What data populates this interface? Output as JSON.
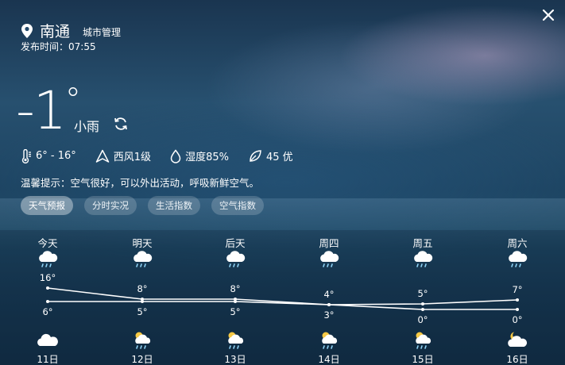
{
  "location": {
    "city": "南通",
    "manage_label": "城市管理",
    "icon": "location-pin-icon"
  },
  "publish": {
    "label": "发布时间：",
    "time": "07:55"
  },
  "current": {
    "temp": "-1",
    "unit": "°",
    "condition": "小雨",
    "range": "6° - 16°",
    "wind": "西风1级",
    "humidity": "湿度85%",
    "aqi": "45 优"
  },
  "tip": "温馨提示：空气很好，可以外出活动，呼吸新鲜空气。",
  "tabs": [
    "天气预报",
    "分时实况",
    "生活指数",
    "空气指数"
  ],
  "active_tab": "天气预报",
  "forecast": {
    "days": [
      "今天",
      "明天",
      "后天",
      "周四",
      "周五",
      "周六"
    ],
    "dates": [
      "11日",
      "12日",
      "13日",
      "14日",
      "15日",
      "16日"
    ],
    "highs": [
      16,
      8,
      8,
      4,
      5,
      7
    ],
    "lows": [
      6,
      5,
      5,
      3,
      0,
      0
    ],
    "high_labels": [
      "16°",
      "8°",
      "8°",
      "4°",
      "5°",
      "7°"
    ],
    "low_labels": [
      "6°",
      "5°",
      "5°",
      "3°",
      "0°",
      "0°"
    ],
    "day_icons": [
      "light-rain-icon",
      "light-rain-icon",
      "light-rain-icon",
      "light-rain-icon",
      "light-rain-icon",
      "light-rain-icon"
    ],
    "night_icons": [
      "cloudy-icon",
      "partly-cloudy-rain-icon",
      "partly-cloudy-rain-icon",
      "partly-cloudy-rain-icon",
      "partly-cloudy-rain-icon",
      "partly-cloudy-moon-icon"
    ]
  },
  "colors": {
    "text": "#ffffff",
    "tab_bg": "#3d5f7e",
    "line": "#ffffff"
  }
}
